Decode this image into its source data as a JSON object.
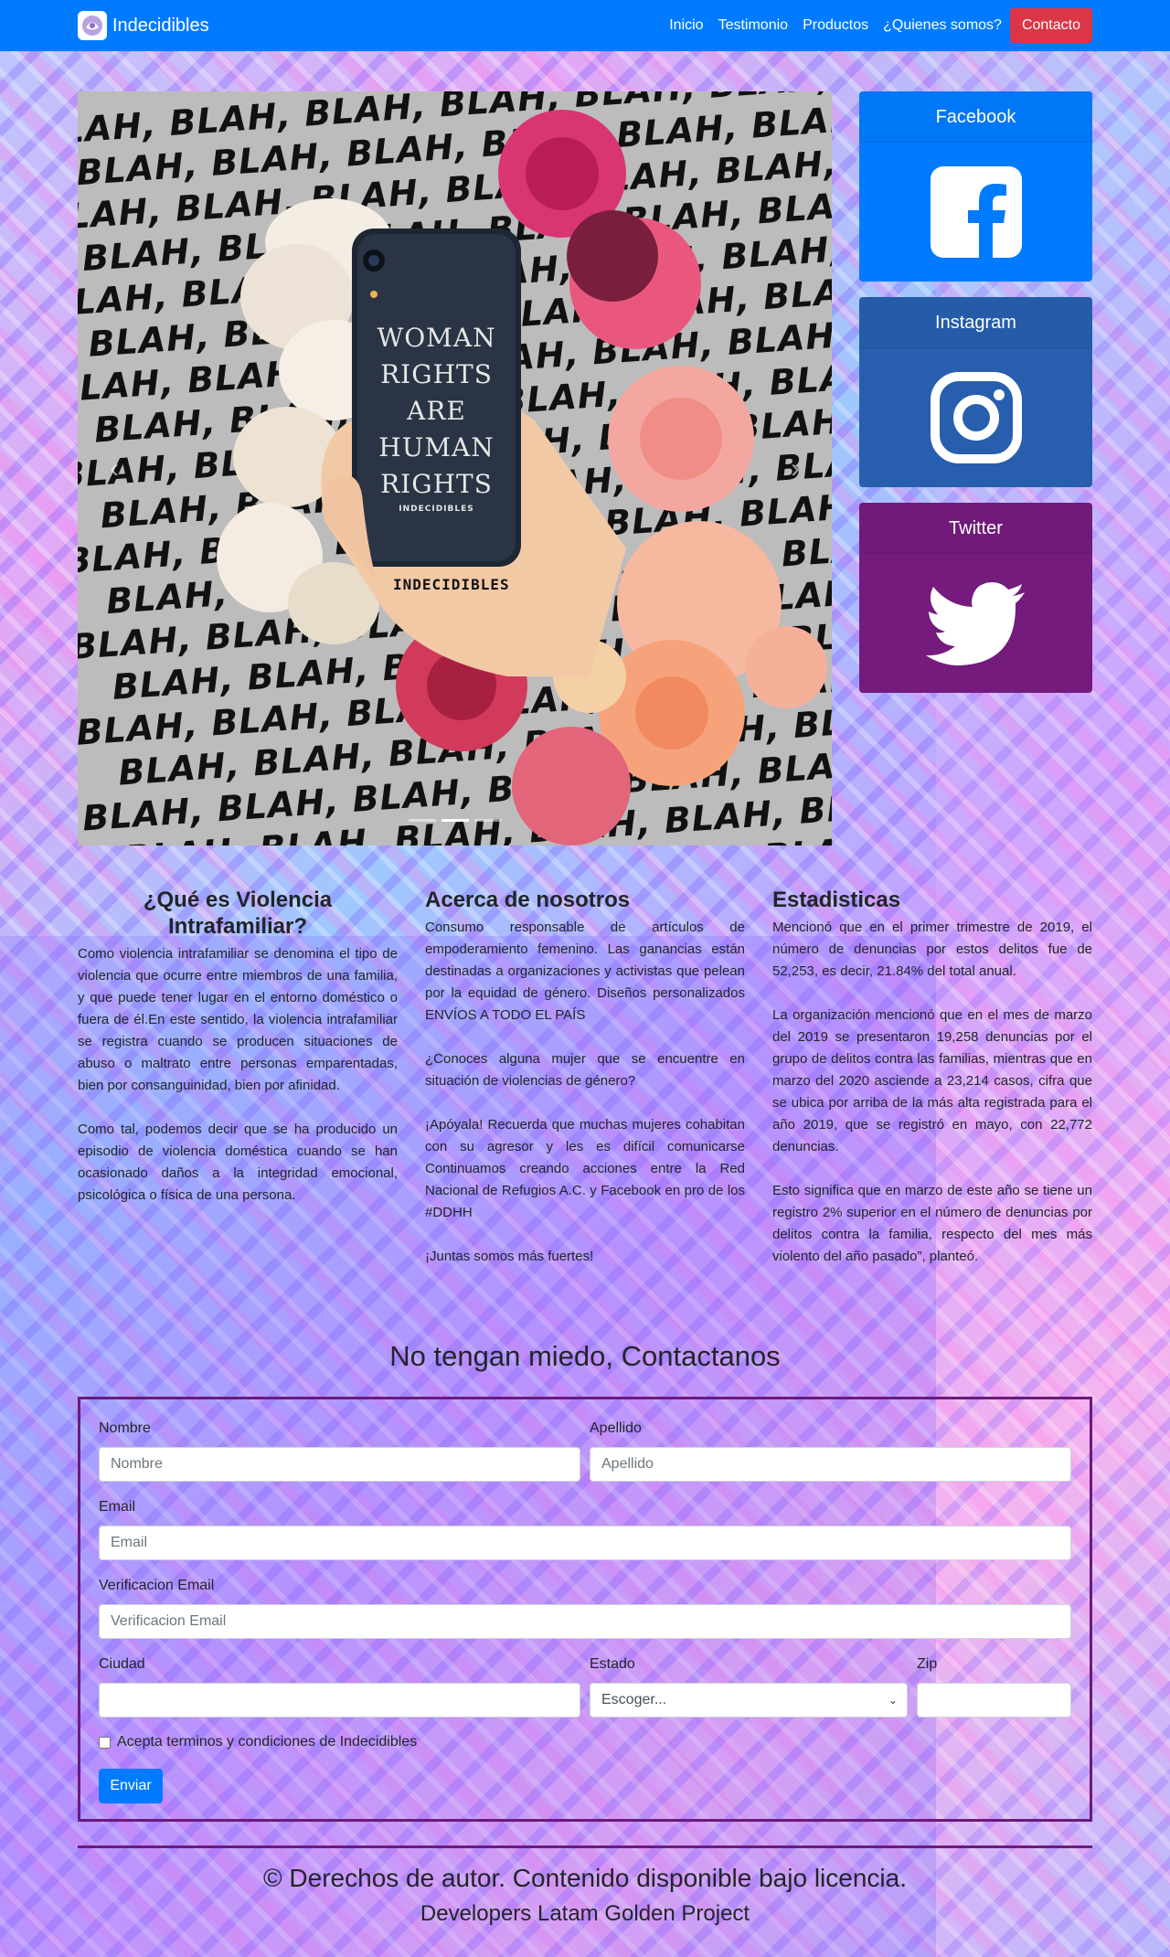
{
  "navbar": {
    "brand": "Indecidibles",
    "links": [
      "Inicio",
      "Testimonio",
      "Productos",
      "¿Quienes somos?"
    ],
    "cta": "Contacto",
    "bg_color": "#007bff",
    "cta_color": "#dc3545"
  },
  "hero": {
    "phone_lines": [
      "WOMAN",
      "RIGHTS",
      "ARE",
      "HUMAN",
      "RIGHTS"
    ],
    "phone_brand": "INDECIDIBLES",
    "signature": "INDECIDIBLES",
    "blah": "BLAH,",
    "prev_icon": "chevron-left-icon",
    "next_icon": "chevron-right-icon"
  },
  "social": [
    {
      "name": "Facebook",
      "icon": "facebook-icon",
      "color": "#007bff"
    },
    {
      "name": "Instagram",
      "icon": "instagram-icon",
      "color": "#275fae"
    },
    {
      "name": "Twitter",
      "icon": "twitter-icon",
      "color": "#751b7e"
    }
  ],
  "info": {
    "violencia": {
      "title": "¿Qué es Violencia Intrafamiliar?",
      "p1": "Como violencia intrafamiliar se denomina el tipo de violencia que ocurre entre miembros de una familia, y que puede tener lugar en el entorno doméstico o fuera de él.En este sentido, la violencia intrafamiliar se registra cuando se producen situaciones de abuso o maltrato entre personas emparentadas, bien por consanguinidad, bien por afinidad.",
      "p2": "Como tal, podemos decir que se ha producido un episodio de violencia doméstica cuando se han ocasionado daños a la integridad emocional, psicológica o física de una persona."
    },
    "acerca": {
      "title": "Acerca de nosotros",
      "p1": "Consumo responsable de artículos de empoderamiento femenino. Las ganancias están destinadas a organizaciones y activistas que pelean por la equidad de género. Diseños personalizados ENVÍOS A TODO EL PAÍS",
      "p2": "¿Conoces alguna mujer que se encuentre en situación de violencias de género?",
      "p3": "¡Apóyala! Recuerda que muchas mujeres cohabitan con su agresor y les es difícil comunicarse Continuamos creando acciones entre la Red Nacional de Refugios A.C. y Facebook en pro de los #DDHH",
      "p4": "¡Juntas somos más fuertes!"
    },
    "estadisticas": {
      "title": "Estadisticas",
      "p1": "Mencionó que en el primer trimestre de 2019, el número de denuncias por estos delitos fue de 52,253, es decir, 21.84% del total anual.",
      "p2": "La organización mencionó que en el mes de marzo del 2019 se presentaron 19,258 denuncias por el grupo de delitos contra las familias, mientras que en marzo del 2020 asciende a 23,214 casos, cifra que se ubica por arriba de la más alta registrada para el año 2019, que se registró en mayo, con 22,772 denuncias.",
      "p3": "Esto significa que en marzo de este año se tiene un registro 2% superior en el número de denuncias por delitos contra la familia, respecto del mes más violento del año pasado”, planteó."
    }
  },
  "contact": {
    "title": "No tengan miedo, Contactanos",
    "nombre_label": "Nombre",
    "nombre_placeholder": "Nombre",
    "apellido_label": "Apellido",
    "apellido_placeholder": "Apellido",
    "email_label": "Email",
    "email_placeholder": "Email",
    "verif_label": "Verificacion Email",
    "verif_placeholder": "Verificacion Email",
    "ciudad_label": "Ciudad",
    "estado_label": "Estado",
    "estado_value": "Escoger...",
    "zip_label": "Zip",
    "terms": "Acepta terminos y condiciones de Indecidibles",
    "submit": "Enviar",
    "border_color": "#6a1b7a"
  },
  "footer": {
    "line1": "© Derechos de autor. Contenido disponible bajo licencia.",
    "line2": "Developers Latam Golden Project"
  }
}
